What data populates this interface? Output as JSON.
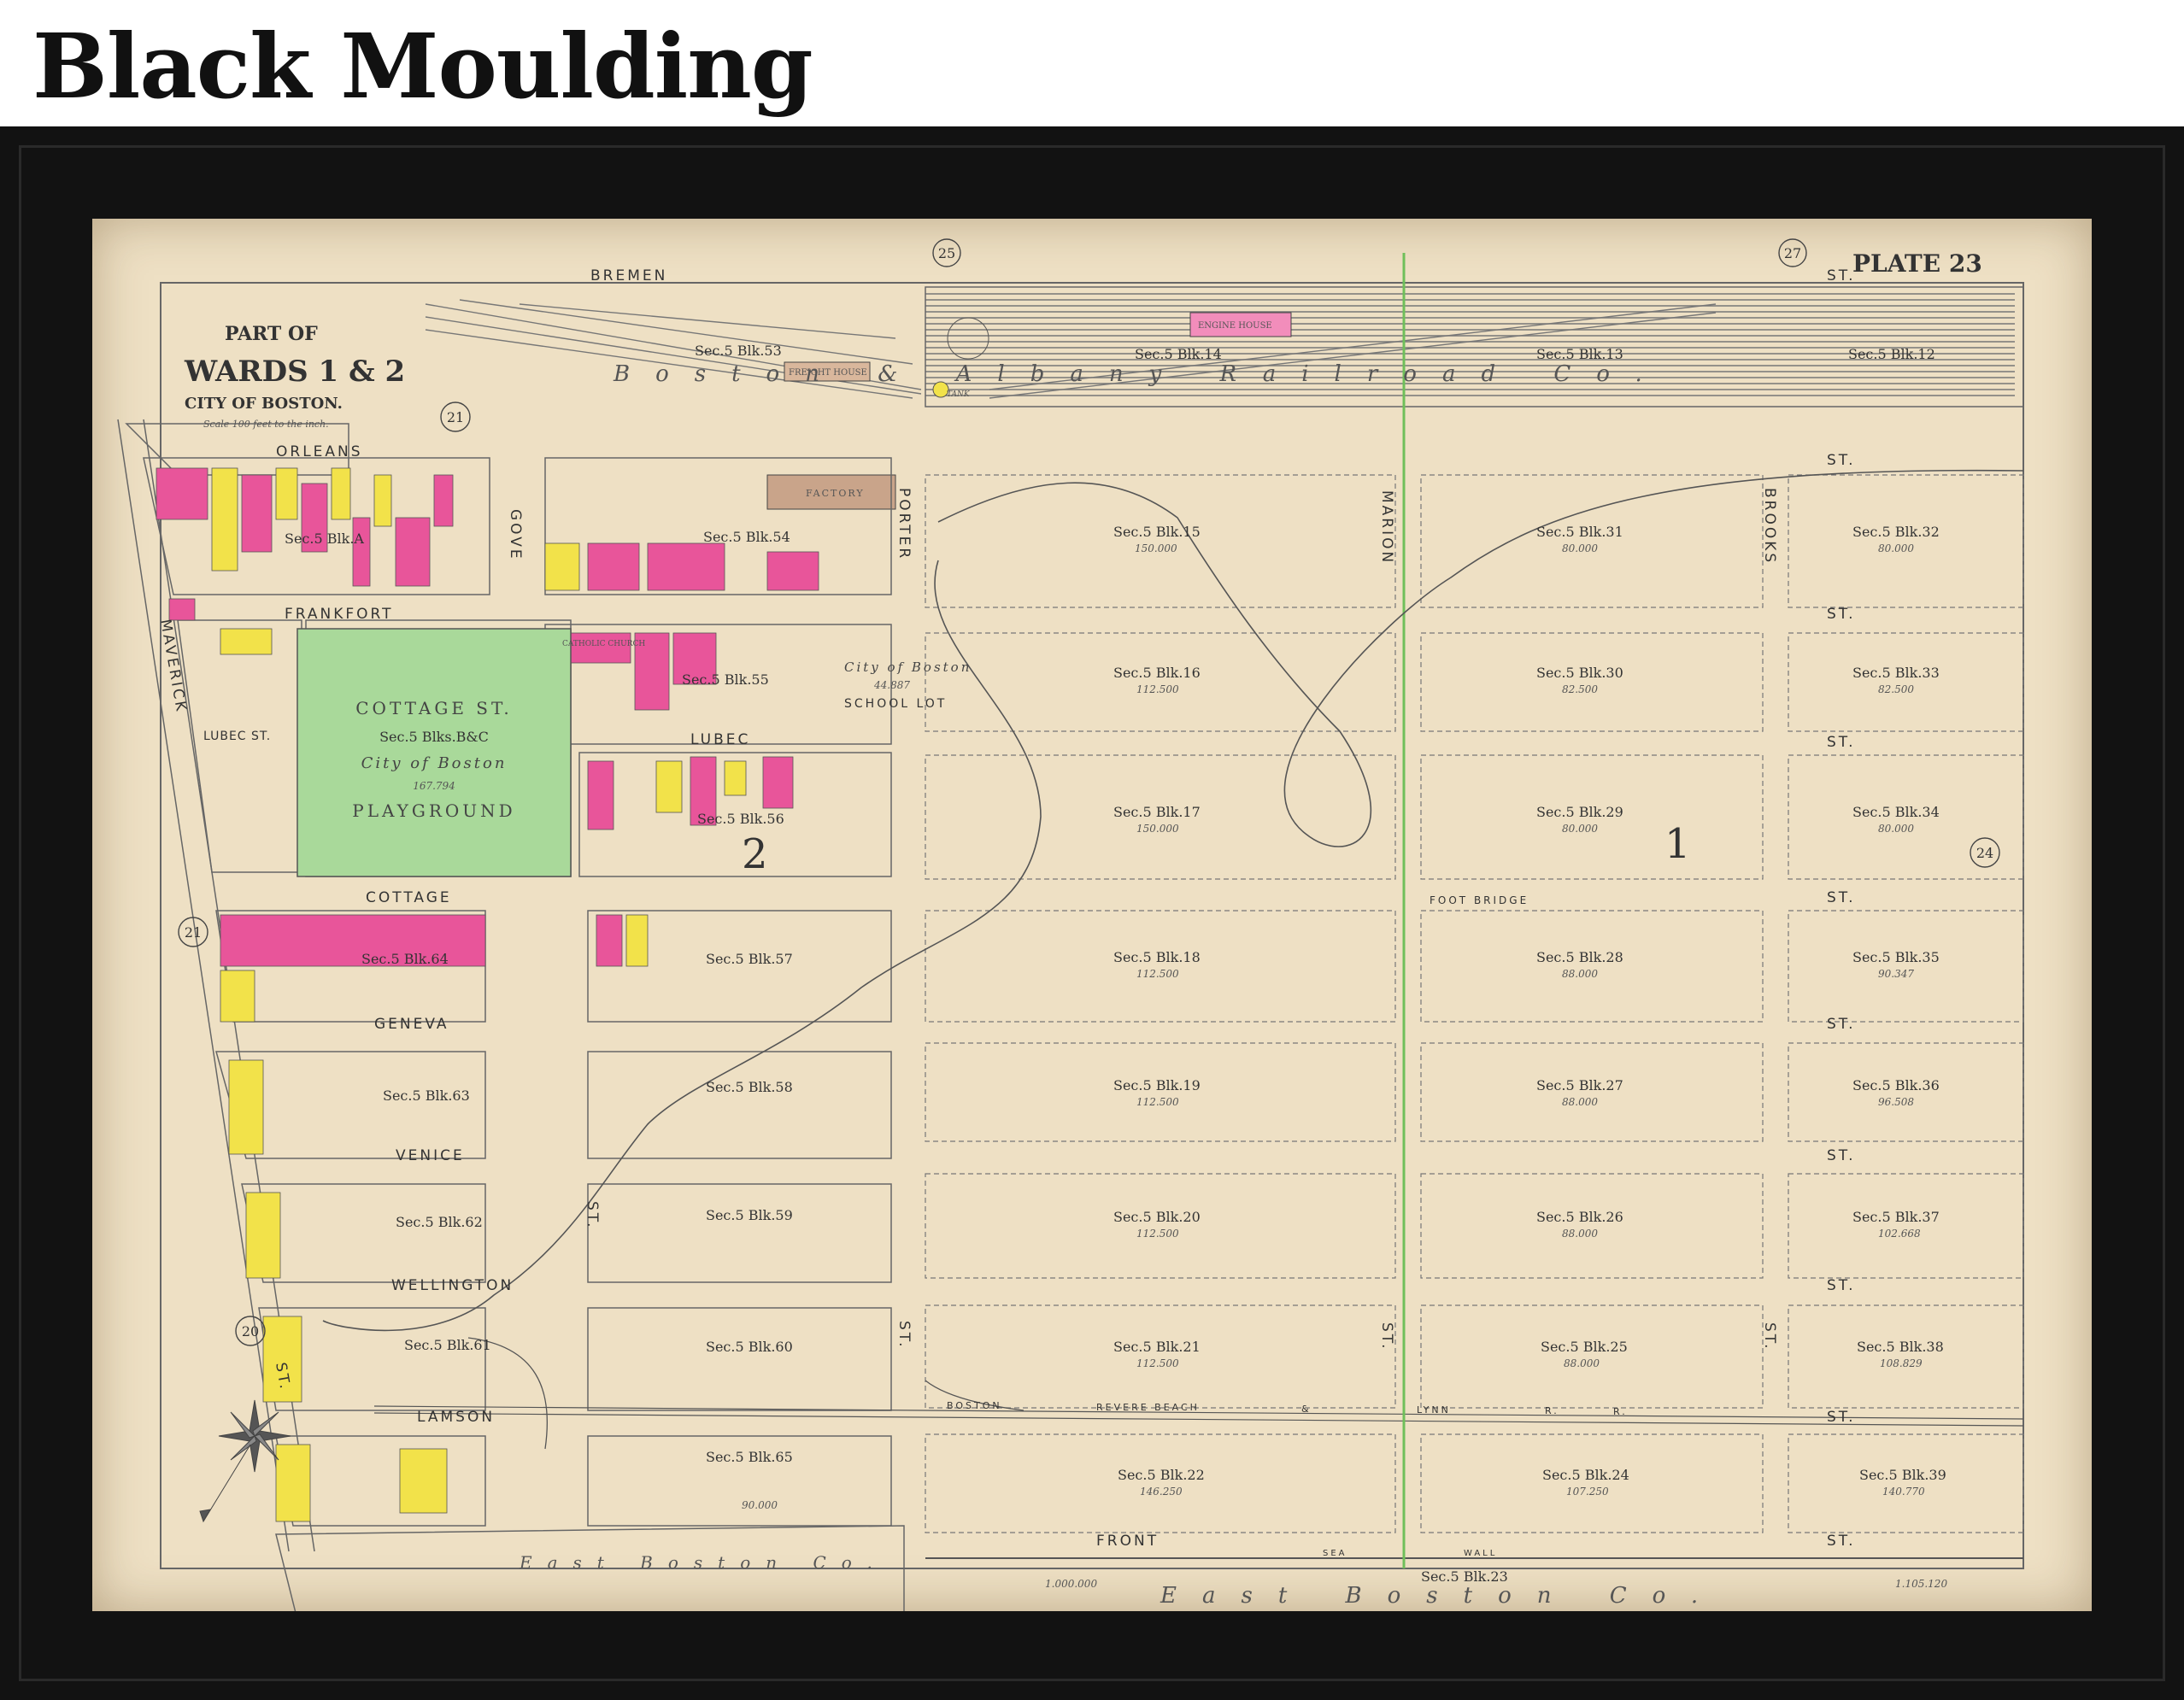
{
  "header": {
    "title": "Black Moulding"
  },
  "map": {
    "plate": "PLATE 23",
    "title_lines": [
      "PART OF",
      "WARDS 1 & 2",
      "CITY OF BOSTON."
    ],
    "scale": "Scale 100 feet to the inch.",
    "wards": [
      "21",
      "25",
      "27",
      "21",
      "20",
      "24"
    ],
    "big_wards": [
      "2",
      "1"
    ],
    "streets": {
      "bremen": "BREMEN",
      "st": "ST.",
      "orleans": "ORLEANS",
      "frankfort": "FRANKFORT",
      "maverick": "MAVERICK",
      "lubec_st": "LUBEC ST.",
      "lubec": "LUBEC",
      "cottage": "COTTAGE",
      "geneva": "GENEVA",
      "venice": "VENICE",
      "wellington": "WELLINGTON",
      "lamson": "LAMSON",
      "front": "FRONT",
      "gove": "GOVE",
      "porter": "PORTER",
      "marion": "MARION",
      "brooks": "BROOKS",
      "foot_bridge": "FOOT BRIDGE",
      "railroad": [
        "BOSTON",
        "REVERE BEACH",
        "&",
        "LYNN",
        "R.",
        "R."
      ],
      "sea_wall": [
        "SEA",
        "WALL"
      ]
    },
    "railroad_company": "Boston & Albany Railroad Co.",
    "owner_east_boston": "East Boston Co.",
    "park": {
      "line1": "COTTAGE ST.",
      "line2": "Sec.5 Blks.B&C",
      "line3": "City of Boston",
      "line4": "167.794",
      "line5": "PLAYGROUND"
    },
    "school": {
      "line1": "City of Boston",
      "line2": "44.887",
      "line3": "SCHOOL LOT"
    },
    "buildings": {
      "engine_house": "ENGINE HOUSE",
      "freight_house": "FREIGHT HOUSE",
      "factory": "FACTORY",
      "tank": "TANK",
      "catholic_church": "CATHOLIC CHURCH"
    },
    "left_blocks": [
      {
        "label": "Sec.5 Blk.53"
      },
      {
        "label": "Sec.5 Blk.A"
      },
      {
        "label": "Sec.5 Blk.54"
      },
      {
        "label": "Sec.5 Blk.55"
      },
      {
        "label": "Sec.5 Blk.56"
      },
      {
        "label": "Sec.5 Blk.64"
      },
      {
        "label": "Sec.5 Blk.57"
      },
      {
        "label": "Sec.5 Blk.63"
      },
      {
        "label": "Sec.5 Blk.58"
      },
      {
        "label": "Sec.5 Blk.62"
      },
      {
        "label": "Sec.5 Blk.59"
      },
      {
        "label": "Sec.5 Blk.61"
      },
      {
        "label": "Sec.5 Blk.60"
      },
      {
        "label": "Sec.5 Blk.65",
        "area": "90.000"
      }
    ],
    "rail_blocks": [
      "Sec.5 Blk.14",
      "Sec.5 Blk.13",
      "Sec.5 Blk.12"
    ],
    "grid_blocks": [
      {
        "label": "Sec.5 Blk.15",
        "area": "150.000"
      },
      {
        "label": "Sec.5 Blk.31",
        "area": "80.000"
      },
      {
        "label": "Sec.5 Blk.32",
        "area": "80.000"
      },
      {
        "label": "Sec.5 Blk.16",
        "area": "112.500"
      },
      {
        "label": "Sec.5 Blk.30",
        "area": "82.500"
      },
      {
        "label": "Sec.5 Blk.33",
        "area": "82.500"
      },
      {
        "label": "Sec.5 Blk.17",
        "area": "150.000"
      },
      {
        "label": "Sec.5 Blk.29",
        "area": "80.000"
      },
      {
        "label": "Sec.5 Blk.34",
        "area": "80.000"
      },
      {
        "label": "Sec.5 Blk.18",
        "area": "112.500"
      },
      {
        "label": "Sec.5 Blk.28",
        "area": "88.000"
      },
      {
        "label": "Sec.5 Blk.35",
        "area": "90.347"
      },
      {
        "label": "Sec.5 Blk.19",
        "area": "112.500"
      },
      {
        "label": "Sec.5 Blk.27",
        "area": "88.000"
      },
      {
        "label": "Sec.5 Blk.36",
        "area": "96.508"
      },
      {
        "label": "Sec.5 Blk.20",
        "area": "112.500"
      },
      {
        "label": "Sec.5 Blk.26",
        "area": "88.000"
      },
      {
        "label": "Sec.5 Blk.37",
        "area": "102.668"
      },
      {
        "label": "Sec.5 Blk.21",
        "area": "112.500"
      },
      {
        "label": "Sec.5 Blk.25",
        "area": "88.000"
      },
      {
        "label": "Sec.5 Blk.38",
        "area": "108.829"
      },
      {
        "label": "Sec.5 Blk.22",
        "area": "146.250"
      },
      {
        "label": "Sec.5 Blk.24",
        "area": "107.250"
      },
      {
        "label": "Sec.5 Blk.39",
        "area": "140.770"
      }
    ],
    "bottom_block": "Sec.5 Blk.23",
    "bottom_areas": [
      "1.000.000",
      "1.105.120"
    ],
    "palette": {
      "paper": "#eee0c4",
      "pink": "#e8559a",
      "yellow": "#f2e24a",
      "green": "#a9d99a",
      "line": "#6a6a6a",
      "ward_line": "#6fbf5a"
    }
  }
}
